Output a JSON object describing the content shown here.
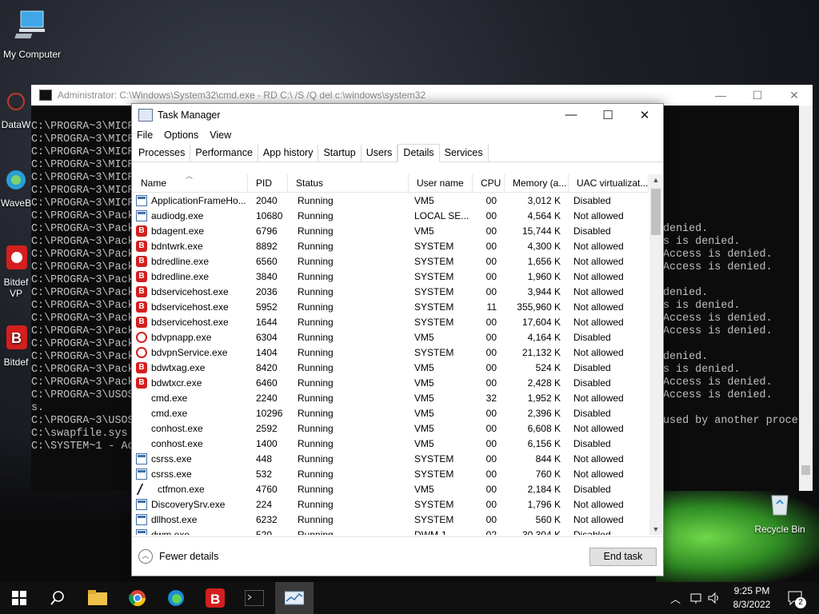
{
  "desktop": {
    "icons": [
      {
        "label": "My Computer"
      },
      {
        "label": "DataW"
      },
      {
        "label": "WaveB"
      },
      {
        "label": "Bitdef VP"
      },
      {
        "label": "Bitdef"
      },
      {
        "label": "Recycle Bin"
      }
    ]
  },
  "cmd": {
    "title": "Administrator: C:\\Windows\\System32\\cmd.exe - RD  C:\\ /S /Q del c:\\windows\\system32",
    "left_lines": [
      "C:\\PROGRA~3\\MICR",
      "C:\\PROGRA~3\\MICR",
      "C:\\PROGRA~3\\MICR",
      "C:\\PROGRA~3\\MICR",
      "C:\\PROGRA~3\\MICR",
      "C:\\PROGRA~3\\MICR",
      "C:\\PROGRA~3\\MICR",
      "C:\\PROGRA~3\\Pack",
      "C:\\PROGRA~3\\Pack",
      "C:\\PROGRA~3\\Pack",
      "C:\\PROGRA~3\\Pack",
      "C:\\PROGRA~3\\Pack",
      "C:\\PROGRA~3\\Pack",
      "C:\\PROGRA~3\\Pack",
      "C:\\PROGRA~3\\Pack",
      "C:\\PROGRA~3\\Pack",
      "C:\\PROGRA~3\\Pack",
      "C:\\PROGRA~3\\Pack",
      "C:\\PROGRA~3\\Pack",
      "C:\\PROGRA~3\\Pack",
      "C:\\PROGRA~3\\Pack",
      "C:\\PROGRA~3\\USOS",
      "s.",
      "C:\\PROGRA~3\\USOS",
      "C:\\swapfile.sys",
      "C:\\SYSTEM~1 - Ac"
    ],
    "right_lines": [
      "denied.",
      "s is denied.",
      "Access is denied.",
      "Access is denied.",
      "",
      "denied.",
      "s is denied.",
      "Access is denied.",
      "Access is denied.",
      "",
      "denied.",
      "s is denied.",
      "Access is denied.",
      "Access is denied.",
      "",
      "used by another proces"
    ]
  },
  "taskmanager": {
    "title": "Task Manager",
    "menu": [
      "File",
      "Options",
      "View"
    ],
    "tabs": [
      "Processes",
      "Performance",
      "App history",
      "Startup",
      "Users",
      "Details",
      "Services"
    ],
    "active_tab": "Details",
    "columns": [
      "Name",
      "PID",
      "Status",
      "User name",
      "CPU",
      "Memory (a...",
      "UAC virtualizat..."
    ],
    "rows": [
      {
        "icon": "window",
        "name": "ApplicationFrameHo...",
        "pid": "2040",
        "status": "Running",
        "user": "VM5",
        "cpu": "00",
        "mem": "3,012 K",
        "uac": "Disabled"
      },
      {
        "icon": "window",
        "name": "audiodg.exe",
        "pid": "10680",
        "status": "Running",
        "user": "LOCAL SE...",
        "cpu": "00",
        "mem": "4,564 K",
        "uac": "Not allowed"
      },
      {
        "icon": "bd",
        "name": "bdagent.exe",
        "pid": "6796",
        "status": "Running",
        "user": "VM5",
        "cpu": "00",
        "mem": "15,744 K",
        "uac": "Disabled"
      },
      {
        "icon": "bd",
        "name": "bdntwrk.exe",
        "pid": "8892",
        "status": "Running",
        "user": "SYSTEM",
        "cpu": "00",
        "mem": "4,300 K",
        "uac": "Not allowed"
      },
      {
        "icon": "bd",
        "name": "bdredline.exe",
        "pid": "6560",
        "status": "Running",
        "user": "SYSTEM",
        "cpu": "00",
        "mem": "1,656 K",
        "uac": "Not allowed"
      },
      {
        "icon": "bd",
        "name": "bdredline.exe",
        "pid": "3840",
        "status": "Running",
        "user": "SYSTEM",
        "cpu": "00",
        "mem": "1,960 K",
        "uac": "Not allowed"
      },
      {
        "icon": "bd",
        "name": "bdservicehost.exe",
        "pid": "2036",
        "status": "Running",
        "user": "SYSTEM",
        "cpu": "00",
        "mem": "3,944 K",
        "uac": "Not allowed"
      },
      {
        "icon": "bd",
        "name": "bdservicehost.exe",
        "pid": "5952",
        "status": "Running",
        "user": "SYSTEM",
        "cpu": "11",
        "mem": "355,960 K",
        "uac": "Not allowed"
      },
      {
        "icon": "bd",
        "name": "bdservicehost.exe",
        "pid": "1644",
        "status": "Running",
        "user": "SYSTEM",
        "cpu": "00",
        "mem": "17,604 K",
        "uac": "Not allowed"
      },
      {
        "icon": "shield",
        "name": "bdvpnapp.exe",
        "pid": "6304",
        "status": "Running",
        "user": "VM5",
        "cpu": "00",
        "mem": "4,164 K",
        "uac": "Disabled"
      },
      {
        "icon": "shield",
        "name": "bdvpnService.exe",
        "pid": "1404",
        "status": "Running",
        "user": "SYSTEM",
        "cpu": "00",
        "mem": "21,132 K",
        "uac": "Not allowed"
      },
      {
        "icon": "bd",
        "name": "bdwtxag.exe",
        "pid": "8420",
        "status": "Running",
        "user": "VM5",
        "cpu": "00",
        "mem": "524 K",
        "uac": "Disabled"
      },
      {
        "icon": "bd",
        "name": "bdwtxcr.exe",
        "pid": "6460",
        "status": "Running",
        "user": "VM5",
        "cpu": "00",
        "mem": "2,428 K",
        "uac": "Disabled"
      },
      {
        "icon": "cmd",
        "name": "cmd.exe",
        "pid": "2240",
        "status": "Running",
        "user": "VM5",
        "cpu": "32",
        "mem": "1,952 K",
        "uac": "Not allowed"
      },
      {
        "icon": "cmd",
        "name": "cmd.exe",
        "pid": "10296",
        "status": "Running",
        "user": "VM5",
        "cpu": "00",
        "mem": "2,396 K",
        "uac": "Disabled"
      },
      {
        "icon": "cmd",
        "name": "conhost.exe",
        "pid": "2592",
        "status": "Running",
        "user": "VM5",
        "cpu": "00",
        "mem": "6,608 K",
        "uac": "Not allowed"
      },
      {
        "icon": "cmd",
        "name": "conhost.exe",
        "pid": "1400",
        "status": "Running",
        "user": "VM5",
        "cpu": "00",
        "mem": "6,156 K",
        "uac": "Disabled"
      },
      {
        "icon": "window",
        "name": "csrss.exe",
        "pid": "448",
        "status": "Running",
        "user": "SYSTEM",
        "cpu": "00",
        "mem": "844 K",
        "uac": "Not allowed"
      },
      {
        "icon": "window",
        "name": "csrss.exe",
        "pid": "532",
        "status": "Running",
        "user": "SYSTEM",
        "cpu": "00",
        "mem": "760 K",
        "uac": "Not allowed"
      },
      {
        "icon": "pen",
        "name": "ctfmon.exe",
        "pid": "4760",
        "status": "Running",
        "user": "VM5",
        "cpu": "00",
        "mem": "2,184 K",
        "uac": "Disabled"
      },
      {
        "icon": "window",
        "name": "DiscoverySrv.exe",
        "pid": "224",
        "status": "Running",
        "user": "SYSTEM",
        "cpu": "00",
        "mem": "1,796 K",
        "uac": "Not allowed"
      },
      {
        "icon": "window",
        "name": "dllhost.exe",
        "pid": "6232",
        "status": "Running",
        "user": "SYSTEM",
        "cpu": "00",
        "mem": "560 K",
        "uac": "Not allowed"
      },
      {
        "icon": "window",
        "name": "dwm.exe",
        "pid": "520",
        "status": "Running",
        "user": "DWM-1",
        "cpu": "02",
        "mem": "30,304 K",
        "uac": "Disabled"
      }
    ],
    "footer": {
      "fewer_details": "Fewer details",
      "end_task": "End task"
    }
  },
  "taskbar": {
    "time": "9:25 PM",
    "date": "8/3/2022",
    "notification_count": "2"
  }
}
